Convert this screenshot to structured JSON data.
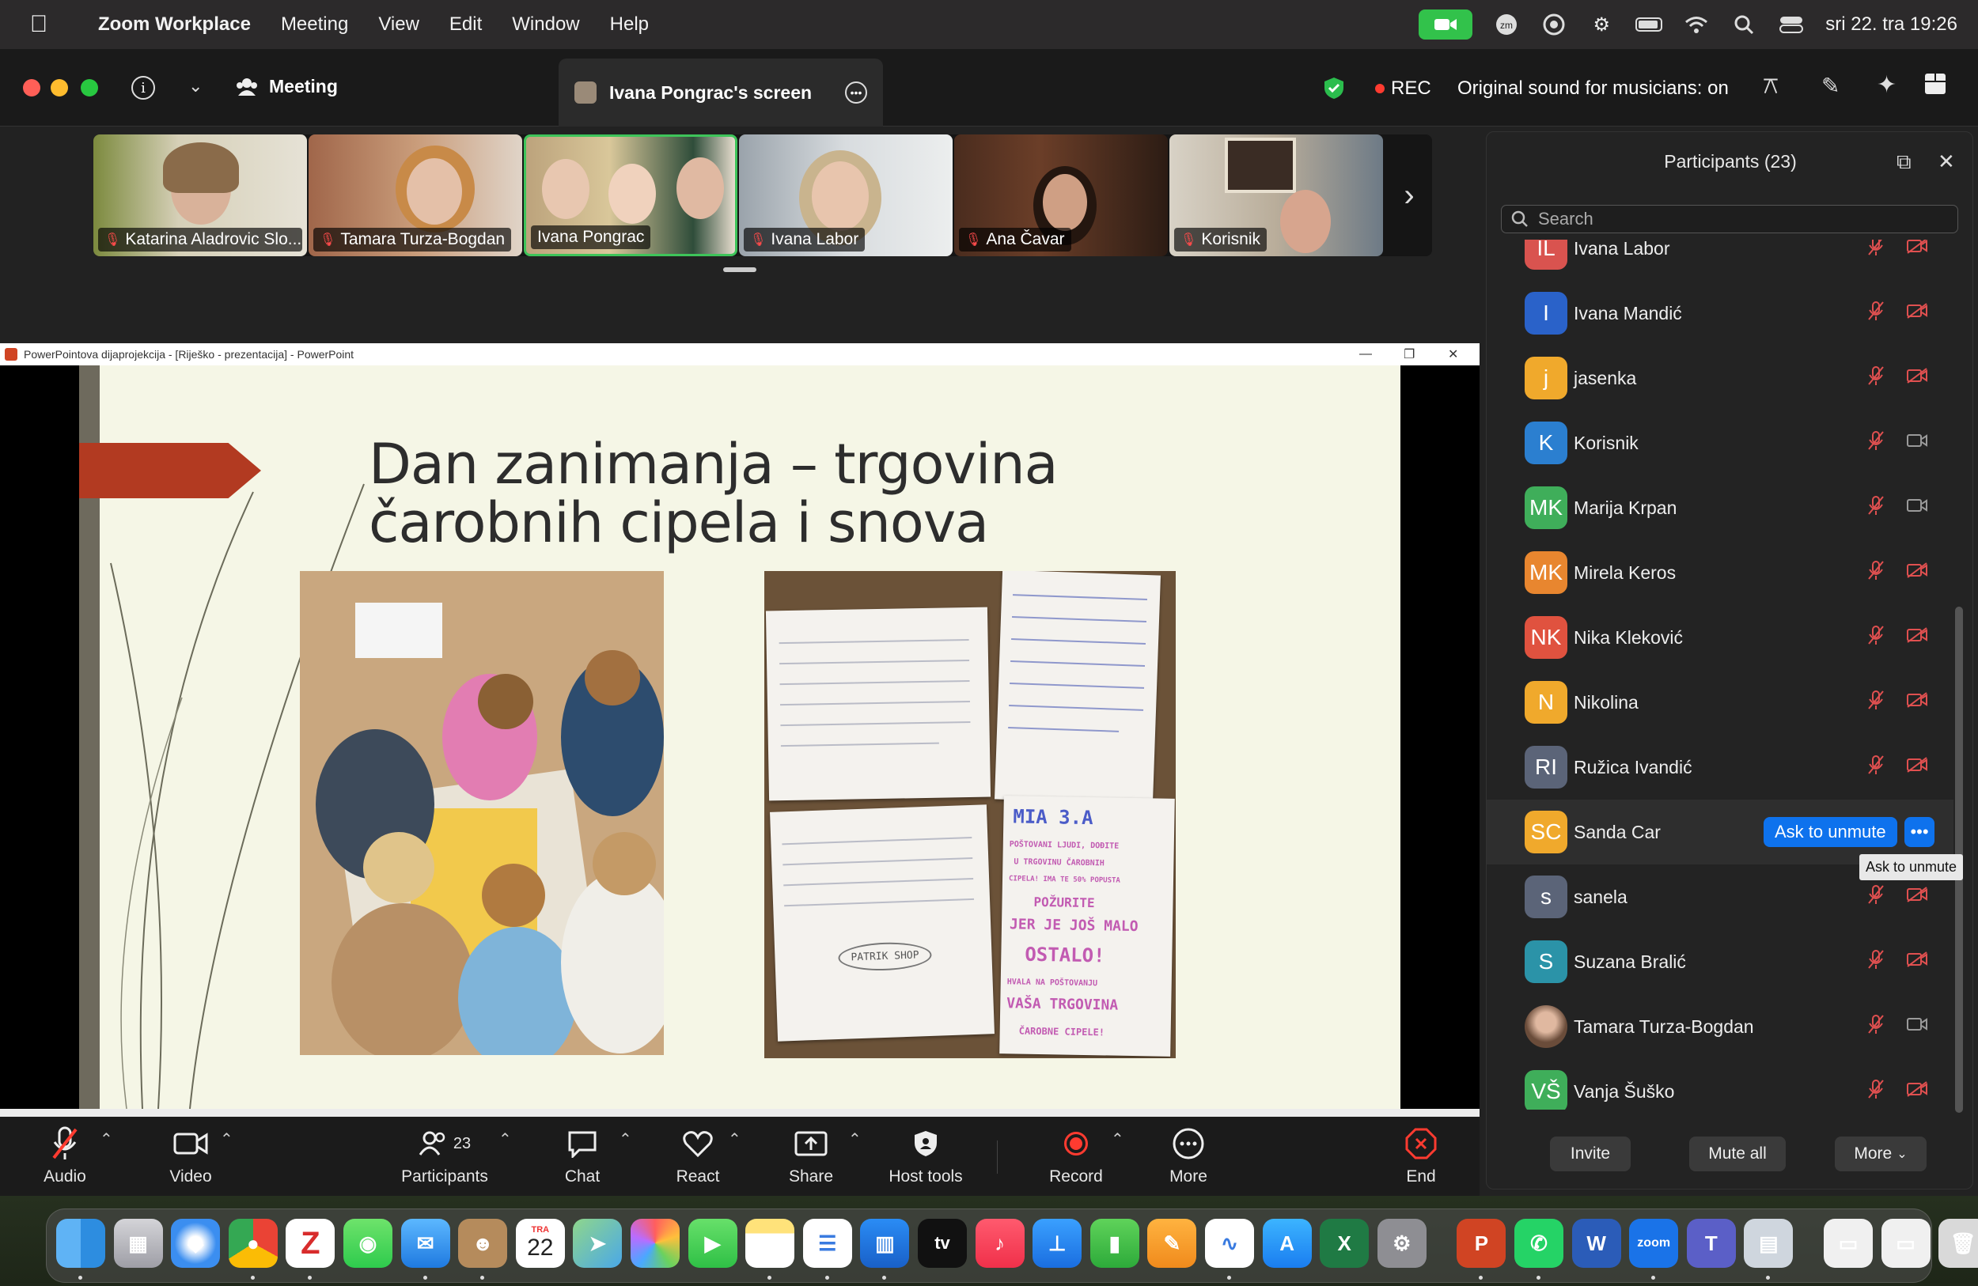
{
  "menubar": {
    "app": "Zoom Workplace",
    "items": [
      "Meeting",
      "View",
      "Edit",
      "Window",
      "Help"
    ],
    "datetime": "sri 22. tra  19:26"
  },
  "titlebar": {
    "meeting_label": "Meeting",
    "share_tab": "Ivana Pongrac's screen",
    "rec_label": "REC",
    "original_sound": "Original sound for musicians: on"
  },
  "gallery": [
    {
      "name": "Katarina Aladrovic Slo...",
      "muted": true
    },
    {
      "name": "Tamara Turza-Bogdan",
      "muted": true
    },
    {
      "name": "Ivana Pongrac",
      "muted": false,
      "active": true
    },
    {
      "name": "Ivana Labor",
      "muted": true
    },
    {
      "name": "Ana Čavar",
      "muted": true
    },
    {
      "name": "Korisnik",
      "muted": true
    }
  ],
  "ppt": {
    "window_title": "PowerPointova dijaprojekcija - [Riješko - prezentacija] - PowerPoint",
    "slide_title_line1": "Dan zanimanja – trgovina",
    "slide_title_line2": "čarobnih cipela i snova",
    "note_big": [
      "MIA 3.A",
      "POŠTOVANI LJUDI, DOĐITE",
      "U TRGOVINU ČAROBNIH",
      "CIPELA! IMA TE 50% POPUSTA",
      "POŽURITE",
      "JER JE JOŠ MALO",
      "OSTALO!",
      "HVALA NA POŠTOVANJU",
      "VAŠA TRGOVINA",
      "ČAROBNE CIPELE!"
    ],
    "note_stamp": "PATRIK SHOP"
  },
  "toolbar": {
    "audio": "Audio",
    "video": "Video",
    "participants": "Participants",
    "participants_count": "23",
    "chat": "Chat",
    "react": "React",
    "share": "Share",
    "host_tools": "Host tools",
    "record": "Record",
    "more": "More",
    "end": "End"
  },
  "panel": {
    "title": "Participants (23)",
    "search_placeholder": "Search",
    "participants": [
      {
        "initials": "IL",
        "name": "Ivana Labor",
        "color": "#d9534f",
        "video": false
      },
      {
        "initials": "I",
        "name": "Ivana Mandić",
        "color": "#2a62c9",
        "video": false
      },
      {
        "initials": "j",
        "name": "jasenka",
        "color": "#f0a92c",
        "video": false
      },
      {
        "initials": "K",
        "name": "Korisnik",
        "color": "#2b7fd0",
        "video": true
      },
      {
        "initials": "MK",
        "name": "Marija Krpan",
        "color": "#3fae5a",
        "video": true
      },
      {
        "initials": "MK",
        "name": "Mirela Keros",
        "color": "#e8862f",
        "video": false
      },
      {
        "initials": "NK",
        "name": "Nika Kleković",
        "color": "#e0523f",
        "video": false
      },
      {
        "initials": "N",
        "name": "Nikolina",
        "color": "#f0a92c",
        "video": false
      },
      {
        "initials": "RI",
        "name": "Ružica Ivandić",
        "color": "#5b6478",
        "video": false
      },
      {
        "initials": "SC",
        "name": "Sanda Car",
        "color": "#f0a92c",
        "video": false,
        "hover": true
      },
      {
        "initials": "s",
        "name": "sanela",
        "color": "#5b6478",
        "video": false
      },
      {
        "initials": "S",
        "name": "Suzana Bralić",
        "color": "#2b93a8",
        "video": false
      },
      {
        "initials": "",
        "name": "Tamara Turza-Bogdan",
        "color": "#8a6d5a",
        "video": true
      },
      {
        "initials": "VŠ",
        "name": "Vanja Šuško",
        "color": "#3fae5a",
        "video": false
      }
    ],
    "ask_to_unmute": "Ask to unmute",
    "tooltip": "Ask to unmute",
    "invite": "Invite",
    "mute_all": "Mute all",
    "more": "More"
  },
  "dock": {
    "calendar_month": "TRA",
    "calendar_day": "22",
    "tv_label": "tv",
    "zoom_label": "zoom"
  }
}
